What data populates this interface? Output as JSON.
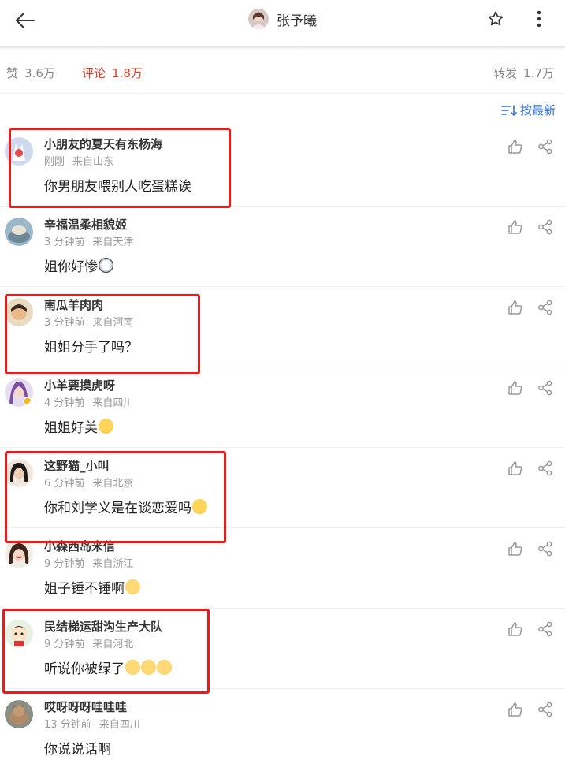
{
  "header": {
    "title": "张予曦",
    "back_icon": "arrow-left-icon",
    "favorite_icon": "star-outline-icon",
    "more_icon": "more-vertical-icon"
  },
  "stats": {
    "like_label": "赞",
    "like_count": "3.6万",
    "comment_label": "评论",
    "comment_count": "1.8万",
    "repost_label": "转发",
    "repost_count": "1.7万"
  },
  "sort": {
    "label": "按最新",
    "icon": "sort-icon"
  },
  "comments": [
    {
      "name": "小朋友的夏天有东杨海",
      "time": "刚刚",
      "location": "来自山东",
      "text": "你男朋友喂别人吃蛋糕诶",
      "emoji": ""
    },
    {
      "name": "辛福温柔相貌姬",
      "time": "3 分钟前",
      "location": "来自天津",
      "text": "姐你好惨",
      "emoji": "shock"
    },
    {
      "name": "南瓜羊肉肉",
      "time": "3 分钟前",
      "location": "来自河南",
      "text": "姐姐分手了吗？",
      "emoji": ""
    },
    {
      "name": "小羊要摸虎呀",
      "time": "4 分钟前",
      "location": "来自四川",
      "text": "姐姐好美",
      "emoji": "cry"
    },
    {
      "name": "这野猫_小叫",
      "time": "6 分钟前",
      "location": "来自北京",
      "text": "你和刘学义是在谈恋爱吗",
      "emoji": "cry"
    },
    {
      "name": "小森西岛米信",
      "time": "9 分钟前",
      "location": "来自浙江",
      "text": "姐子锤不锤啊",
      "emoji": "cat"
    },
    {
      "name": "民结梯运甜沟生产大队",
      "time": "9 分钟前",
      "location": "来自河北",
      "text": "听说你被绿了",
      "emoji": "cat3"
    },
    {
      "name": "哎呀呀呀哇哇哇",
      "time": "13 分钟前",
      "location": "来自四川",
      "text": "你说说话啊",
      "emoji": ""
    }
  ],
  "colors": {
    "accent": "#e03a22",
    "link": "#2f6fd6",
    "highlight_box": "#ea1b1b"
  }
}
